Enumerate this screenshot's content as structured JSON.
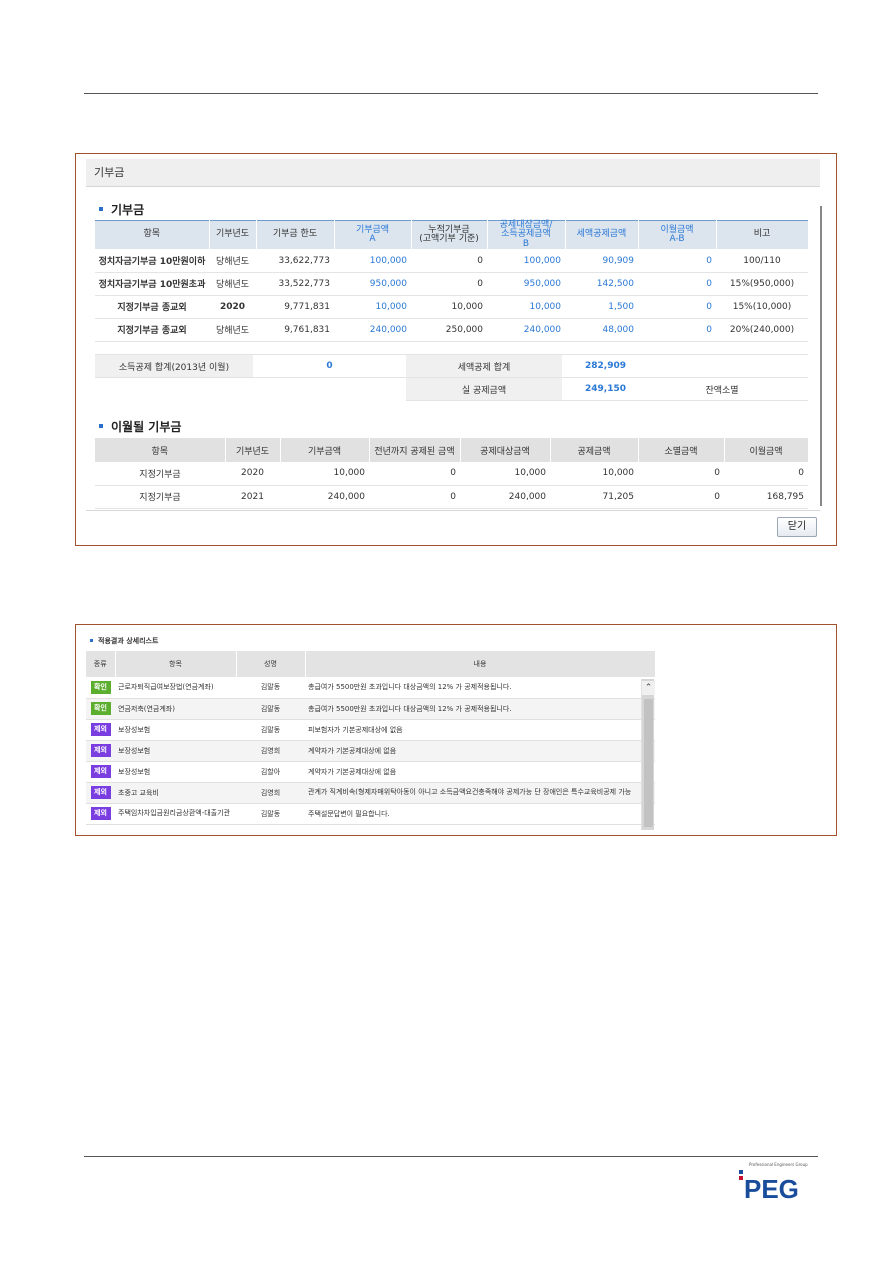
{
  "panel1": {
    "window_title": "기부금",
    "section1_title": "기부금",
    "table1": {
      "headers": [
        {
          "line1": "항목",
          "line2": ""
        },
        {
          "line1": "기부년도",
          "line2": ""
        },
        {
          "line1": "기부금 한도",
          "line2": ""
        },
        {
          "line1": "기부금액",
          "line2": "A"
        },
        {
          "line1": "누적기부금",
          "line2": "(고액기부 기준)"
        },
        {
          "line1": "공제대상금액/",
          "line2": "소득공제금액",
          "line3": "B"
        },
        {
          "line1": "세액공제금액",
          "line2": ""
        },
        {
          "line1": "이월금액",
          "line2": "A-B"
        },
        {
          "line1": "비고",
          "line2": ""
        }
      ],
      "rows": [
        {
          "item": "정치자금기부금 10만원이하",
          "year": "당해년도",
          "limit": "33,622,773",
          "amount": "100,000",
          "cumulative": "0",
          "deductible": "100,000",
          "tax_credit": "90,909",
          "carryover": "0",
          "note": "100/110"
        },
        {
          "item": "정치자금기부금 10만원초과",
          "year": "당해년도",
          "limit": "33,522,773",
          "amount": "950,000",
          "cumulative": "0",
          "deductible": "950,000",
          "tax_credit": "142,500",
          "carryover": "0",
          "note": "15%(950,000)"
        },
        {
          "item": "지정기부금 종교외",
          "year": "2020",
          "limit": "9,771,831",
          "amount": "10,000",
          "cumulative": "10,000",
          "deductible": "10,000",
          "tax_credit": "1,500",
          "carryover": "0",
          "note": "15%(10,000)"
        },
        {
          "item": "지정기부금 종교외",
          "year": "당해년도",
          "limit": "9,761,831",
          "amount": "240,000",
          "cumulative": "250,000",
          "deductible": "240,000",
          "tax_credit": "48,000",
          "carryover": "0",
          "note": "20%(240,000)"
        }
      ]
    },
    "summary": {
      "income_deduction_label": "소득공제 합계(2013년 이월)",
      "income_deduction_value": "0",
      "tax_credit_total_label": "세액공제 합계",
      "tax_credit_total_value": "282,909",
      "actual_deduction_label": "실 공제금액",
      "actual_deduction_value": "249,150",
      "remaining_text": "잔액소멸"
    },
    "section2_title": "이월될 기부금",
    "table2": {
      "headers": [
        "항목",
        "기부년도",
        "기부금액",
        "전년까지 공제된 금액",
        "공제대상금액",
        "공제금액",
        "소멸금액",
        "이월금액"
      ],
      "rows": [
        {
          "item": "지정기부금",
          "year": "2020",
          "amount": "10,000",
          "prev_deducted": "0",
          "deductible": "10,000",
          "deducted": "10,000",
          "expired": "0",
          "carryover": "0"
        },
        {
          "item": "지정기부금",
          "year": "2021",
          "amount": "240,000",
          "prev_deducted": "0",
          "deductible": "240,000",
          "deducted": "71,205",
          "expired": "0",
          "carryover": "168,795"
        }
      ]
    },
    "close_label": "닫기"
  },
  "panel2": {
    "title": "적용결과 상세리스트",
    "headers": [
      "종류",
      "항목",
      "성명",
      "내용"
    ],
    "rows": [
      {
        "badge": "확인",
        "badge_color": "#5cae2e",
        "item": "근로자퇴직급여보장법(연금계좌)",
        "name": "김말동",
        "content": "총급여가 5500만원 초과입니다 대상금액의 12% 가 공제적용됩니다."
      },
      {
        "badge": "확인",
        "badge_color": "#5cae2e",
        "item": "연금저축(연금계좌)",
        "name": "김말동",
        "content": "총급여가 5500만원 초과입니다 대상금액의 12% 가 공제적용됩니다."
      },
      {
        "badge": "제외",
        "badge_color": "#7a3de0",
        "item": "보장성보험",
        "name": "김말동",
        "content": "피보험자가 기본공제대상에 없음"
      },
      {
        "badge": "제외",
        "badge_color": "#7a3de0",
        "item": "보장성보험",
        "name": "김영희",
        "content": "계약자가 기본공제대상에 없음"
      },
      {
        "badge": "제외",
        "badge_color": "#7a3de0",
        "item": "보장성보험",
        "name": "김할아",
        "content": "계약자가 기본공제대상에 없음"
      },
      {
        "badge": "제외",
        "badge_color": "#7a3de0",
        "item": "초중고 교육비",
        "name": "김영희",
        "content": "관계가 직계비속(형제자매위탁아동이 아니고 소득금액요건충족해야 공제가능 단 장애인은 특수교육비공제 가능"
      },
      {
        "badge": "제외",
        "badge_color": "#7a3de0",
        "item": "주택임차차입금원리금상환액-대출기관",
        "name": "김말동",
        "content": "주택설문답변이 필요합니다."
      }
    ]
  },
  "footer": {
    "logo_text": "PEG",
    "logo_subtitle": "Professional Engineers Group"
  },
  "colors": {
    "frame_border": "#a0522d",
    "link_blue": "#2a78d6",
    "header_bg": "#dce4ee",
    "logo_blue": "#1a4c9c",
    "logo_red": "#c8102e"
  }
}
